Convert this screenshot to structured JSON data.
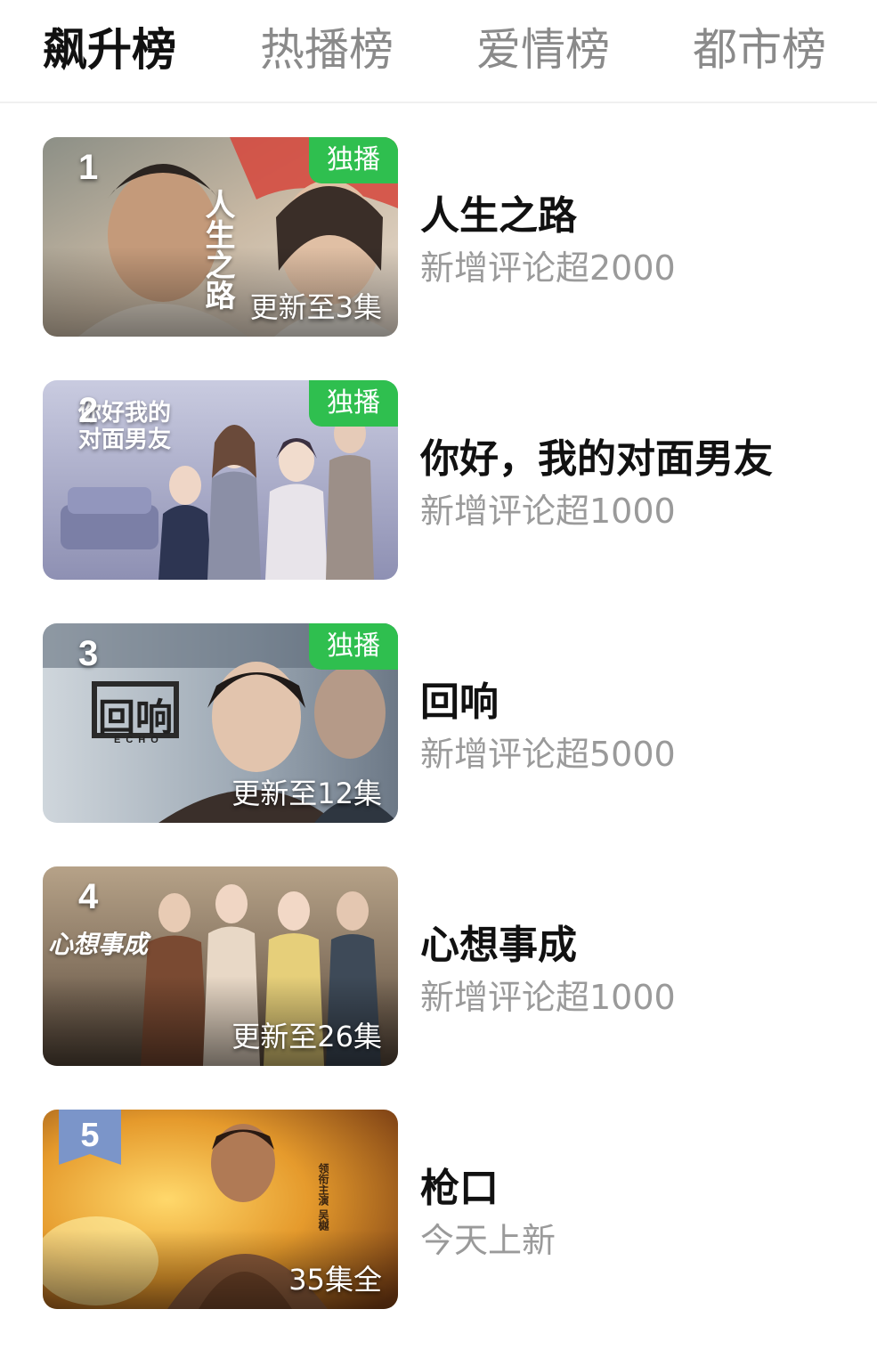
{
  "tabs": [
    {
      "label": "飙升榜",
      "active": true
    },
    {
      "label": "热播榜",
      "active": false
    },
    {
      "label": "爱情榜",
      "active": false
    },
    {
      "label": "都市榜",
      "active": false
    }
  ],
  "items": [
    {
      "rank": "1",
      "title": "人生之路",
      "subtitle": "新增评论超2000",
      "badge": "独播",
      "update": "更新至3集",
      "poster_title": "人生之路"
    },
    {
      "rank": "2",
      "title": "你好，我的对面男友",
      "subtitle": "新增评论超1000",
      "badge": "独播",
      "update": "",
      "poster_title": "你好我的对面男友"
    },
    {
      "rank": "3",
      "title": "回响",
      "subtitle": "新增评论超5000",
      "badge": "独播",
      "update": "更新至12集",
      "poster_title": "回响",
      "poster_subtitle": "ECHO"
    },
    {
      "rank": "4",
      "title": "心想事成",
      "subtitle": "新增评论超1000",
      "badge": "",
      "update": "更新至26集",
      "poster_title": "心想事成"
    },
    {
      "rank": "5",
      "title": "枪口",
      "subtitle": "今天上新",
      "badge": "",
      "update": "35集全",
      "poster_caption": "领衔主演 吴樾"
    }
  ],
  "colors": {
    "accent_green": "#2fbf4f",
    "active_tab_text": "#111111",
    "inactive_tab_text": "#8a8a8a",
    "subtitle_text": "#9a9a9a",
    "rank5_badge": "#7b95c9"
  }
}
